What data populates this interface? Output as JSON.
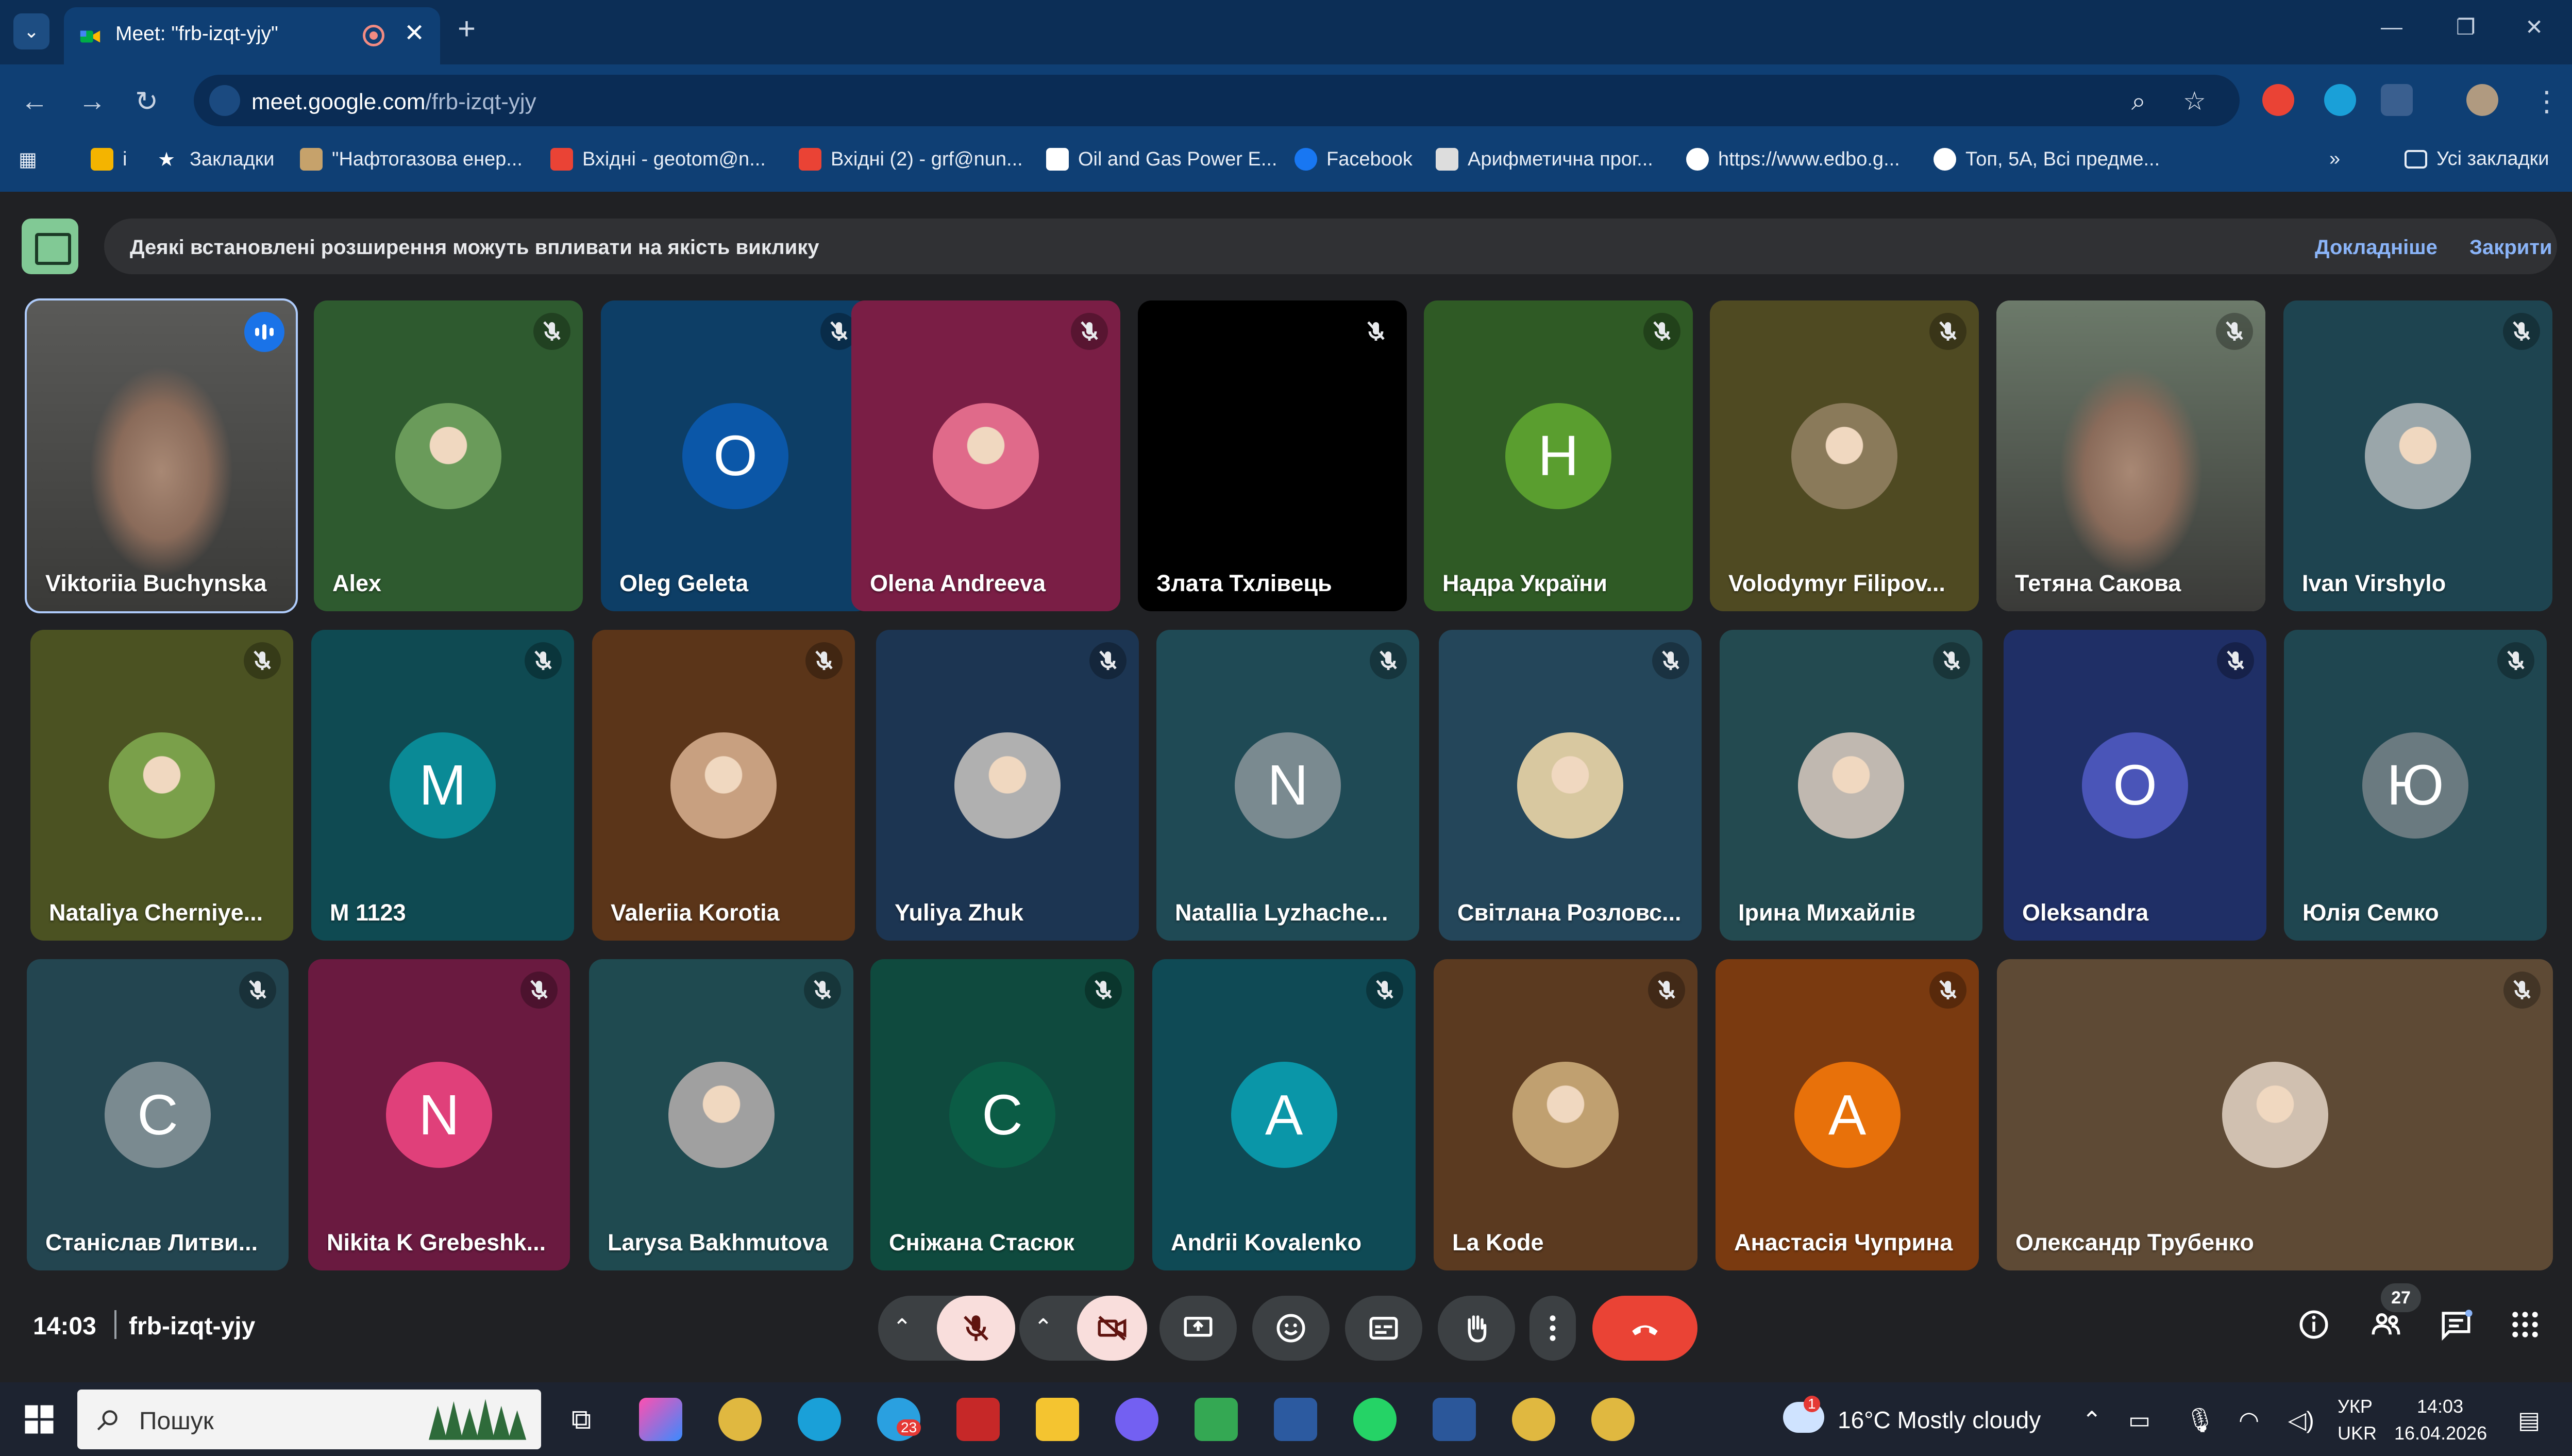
{
  "browser": {
    "tab_title": "Meet: \"frb-izqt-yjy\"",
    "tab_close": "✕",
    "new_tab": "+",
    "url_host": "meet.google.com",
    "url_path": "/frb-izqt-yjy",
    "bookmarks": [
      {
        "label": "і",
        "color": "#f4b400"
      },
      {
        "label": "Закладки",
        "color": "#ffffff"
      },
      {
        "label": "\"Нафтогазова енер...",
        "color": "#c6a26b"
      },
      {
        "label": "Вхідні - geotom@n...",
        "color": "#ea4335"
      },
      {
        "label": "Вхідні (2) - grf@nun...",
        "color": "#ea4335"
      },
      {
        "label": "Oil and Gas Power E...",
        "color": "#ffffff"
      },
      {
        "label": "Facebook",
        "color": "#1877f2"
      },
      {
        "label": "Арифметична прог...",
        "color": "#dddddd"
      },
      {
        "label": "https://www.edbo.g...",
        "color": "#ffffff"
      },
      {
        "label": "Топ, 5А, Всі предме...",
        "color": "#ffffff"
      }
    ],
    "bookmarks_more": "»",
    "all_bookmarks": "Усі закладки"
  },
  "notice": {
    "text": "Деякі встановлені розширення можуть впливати на якість виклику",
    "learn_more": "Докладніше",
    "close": "Закрити"
  },
  "participants": [
    {
      "name": "Viktoriia Buchynska",
      "bg": "#5a5a58",
      "type": "video",
      "speaking": true
    },
    {
      "name": "Alex",
      "bg": "#2e5a2f",
      "type": "photo",
      "photo_color": "#6a9b5a"
    },
    {
      "name": "Oleg Geleta",
      "bg": "#0d3e66",
      "type": "initial",
      "initial": "O",
      "avatar": "#0b57a8"
    },
    {
      "name": "Olena Andreeva",
      "bg": "#7a1e45",
      "type": "photo",
      "photo_color": "#e06a8a"
    },
    {
      "name": "Злата Тхлівець",
      "bg": "#000000",
      "type": "none"
    },
    {
      "name": "Надра України",
      "bg": "#2f5a25",
      "type": "initial",
      "initial": "H",
      "avatar": "#5a9e2f"
    },
    {
      "name": "Volodymyr Filipov...",
      "bg": "#4f4a22",
      "type": "photo",
      "photo_color": "#8a7a5a"
    },
    {
      "name": "Тетяна Сакова",
      "bg": "#6c7a6a",
      "type": "video"
    },
    {
      "name": "Ivan Virshylo",
      "bg": "#1e4450",
      "type": "photo",
      "photo_color": "#9aa6aa"
    },
    {
      "name": "Nataliya Cherniye...",
      "bg": "#4b5222",
      "type": "photo",
      "photo_color": "#7aa04a"
    },
    {
      "name": "M 1123",
      "bg": "#0f4a52",
      "type": "initial",
      "initial": "M",
      "avatar": "#0a8a96"
    },
    {
      "name": "Valeriia Korotia",
      "bg": "#5b3519",
      "type": "photo",
      "photo_color": "#c8a080"
    },
    {
      "name": "Yuliya Zhuk",
      "bg": "#1c3552",
      "type": "photo",
      "photo_color": "#b0b0b0"
    },
    {
      "name": "Natallia Lyzhache...",
      "bg": "#1f4a55",
      "type": "initial",
      "initial": "N",
      "avatar": "#7a8a90"
    },
    {
      "name": "Світлана Розловс...",
      "bg": "#24465a",
      "type": "photo",
      "photo_color": "#d8c8a0"
    },
    {
      "name": "Ірина Михайлів",
      "bg": "#234a50",
      "type": "photo",
      "photo_color": "#c0b8b0"
    },
    {
      "name": "Oleksandra",
      "bg": "#1f2f66",
      "type": "initial",
      "initial": "O",
      "avatar": "#4a55b8"
    },
    {
      "name": "Юлія Семко",
      "bg": "#1f4650",
      "type": "initial",
      "initial": "Ю",
      "avatar": "#6a7a80"
    },
    {
      "name": "Станіслав Литви...",
      "bg": "#234550",
      "type": "initial",
      "initial": "C",
      "avatar": "#7a8a90"
    },
    {
      "name": "Nikita K Grebeshk...",
      "bg": "#6a1a40",
      "type": "initial",
      "initial": "N",
      "avatar": "#e0407a"
    },
    {
      "name": "Larysa Bakhmutova",
      "bg": "#1f4a50",
      "type": "photo",
      "photo_color": "#a0a0a0"
    },
    {
      "name": "Сніжана Стасюк",
      "bg": "#0f4a3e",
      "type": "initial",
      "initial": "C",
      "avatar": "#0b5c45"
    },
    {
      "name": "Andrii Kovalenko",
      "bg": "#0f4a55",
      "type": "initial",
      "initial": "A",
      "avatar": "#0a96a8"
    },
    {
      "name": "La Kode",
      "bg": "#5b3a20",
      "type": "photo",
      "photo_color": "#c0a070"
    },
    {
      "name": "Анастасія Чуприна",
      "bg": "#7a3a10",
      "type": "initial",
      "initial": "A",
      "avatar": "#e8710a"
    },
    {
      "name": "Олександр Трубенко",
      "bg": "#5e4a35",
      "type": "photo",
      "photo_color": "#d0c0b0"
    }
  ],
  "meeting": {
    "time": "14:03",
    "code": "frb-izqt-yjy",
    "people_count": "27"
  },
  "taskbar": {
    "search_placeholder": "Пошук",
    "weather": "16°C  Mostly cloudy",
    "lang_top": "УКР",
    "lang_bottom": "UKR",
    "time": "14:03",
    "date": "16.04.2026",
    "viber_badge": "23",
    "weather_badge": "1"
  },
  "colors": {
    "end_call": "#ea4335",
    "muted_ctrl": "#f9dedc",
    "accent": "#8ab4f8"
  }
}
